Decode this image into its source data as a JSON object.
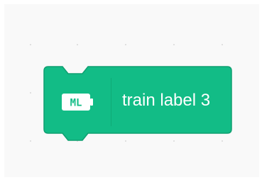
{
  "block": {
    "icon_text": "ML",
    "label": "train label 3",
    "icon": "ml-extension-icon",
    "fill_color": "#12bc86",
    "stroke_color": "#0f9f71",
    "text_color": "#ffffff"
  },
  "workspace": {
    "background_color": "#f9f9f9",
    "grid_dot_color": "#d9d9d9"
  }
}
